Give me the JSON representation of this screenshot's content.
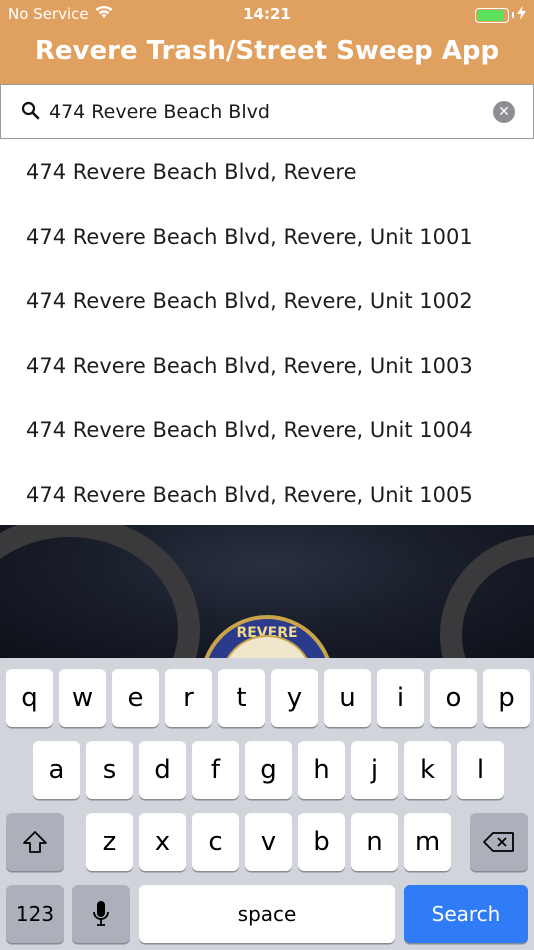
{
  "status_bar": {
    "carrier": "No Service",
    "time": "14:21",
    "battery_level": 0.9,
    "wifi_icon": "wifi-icon",
    "charging_icon": "bolt-icon"
  },
  "header": {
    "title": "Revere Trash/Street Sweep App"
  },
  "search": {
    "value": "474 Revere Beach Blvd",
    "clear_symbol": "✕"
  },
  "suggestions": [
    "474 Revere Beach Blvd, Revere",
    "474 Revere Beach Blvd, Revere, Unit 1001",
    "474 Revere Beach Blvd, Revere, Unit 1002",
    "474 Revere Beach Blvd, Revere, Unit 1003",
    "474 Revere Beach Blvd, Revere, Unit 1004",
    "474 Revere Beach Blvd, Revere, Unit 1005"
  ],
  "seal": {
    "text": "REVERE"
  },
  "keyboard": {
    "row1": [
      "q",
      "w",
      "e",
      "r",
      "t",
      "y",
      "u",
      "i",
      "o",
      "p"
    ],
    "row2": [
      "a",
      "s",
      "d",
      "f",
      "g",
      "h",
      "j",
      "k",
      "l"
    ],
    "row3": [
      "z",
      "x",
      "c",
      "v",
      "b",
      "n",
      "m"
    ],
    "numbers_label": "123",
    "space_label": "space",
    "search_label": "Search",
    "colors": {
      "search_key": "#2f7cf6",
      "header": "#E0A060"
    }
  }
}
